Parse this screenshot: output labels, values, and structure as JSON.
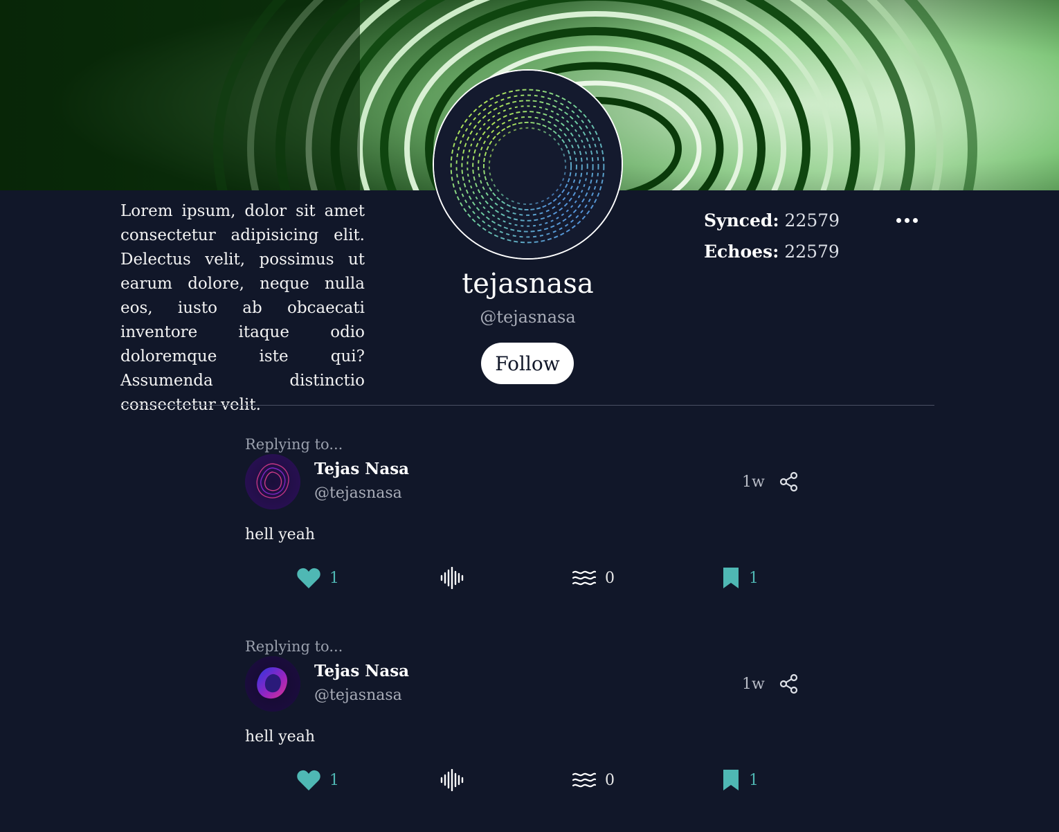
{
  "profile": {
    "bio": "Lorem ipsum, dolor sit amet consectetur adipisicing elit. Delectus velit, possimus ut earum dolore, neque nulla eos, iusto ab obcaecati inventore itaque odio doloremque iste qui? Assumenda distinctio consectetur velit.",
    "display_name": "tejasnasa",
    "handle": "@tejasnasa",
    "follow_label": "Follow",
    "synced_label": "Synced:",
    "synced_value": "22579",
    "echoes_label": "Echoes:",
    "echoes_value": "22579"
  },
  "icons": {
    "more": "more-horizontal-icon",
    "share": "share-icon",
    "like": "heart-icon",
    "audio": "audio-waveform-icon",
    "echo": "waves-icon",
    "bookmark": "bookmark-icon"
  },
  "colors": {
    "background": "#111729",
    "accent_teal": "#4fb8b4",
    "muted_text": "#a9adb8"
  },
  "posts": [
    {
      "replying_label": "Replying to...",
      "author_name": "Tejas Nasa",
      "author_handle": "@tejasnasa",
      "time": "1w",
      "text": "hell yeah",
      "likes": "1",
      "echoes": "0",
      "bookmarks": "1"
    },
    {
      "replying_label": "Replying to...",
      "author_name": "Tejas Nasa",
      "author_handle": "@tejasnasa",
      "time": "1w",
      "text": "hell yeah",
      "likes": "1",
      "echoes": "0",
      "bookmarks": "1"
    }
  ]
}
